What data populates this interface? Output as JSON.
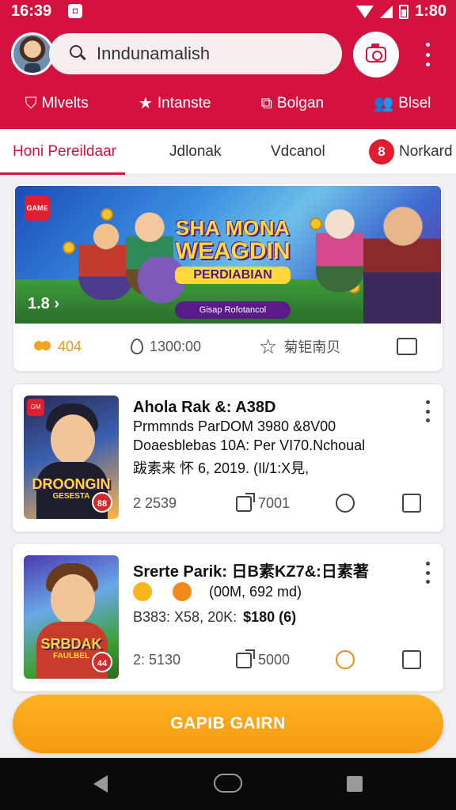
{
  "status_bar": {
    "time": "16:39",
    "right_time": "1:80"
  },
  "header": {
    "search_value": "Inndunamalish",
    "categories": [
      {
        "label": "Mlvelts",
        "icon": "shield-icon"
      },
      {
        "label": "Intanste",
        "icon": "star-icon"
      },
      {
        "label": "Bolgan",
        "icon": "box-icon"
      },
      {
        "label": "Blsel",
        "icon": "users-icon"
      }
    ]
  },
  "tabs": [
    {
      "label": "Honi Pereildaar"
    },
    {
      "label": "Jdlonak"
    },
    {
      "label": "Vdcanol"
    },
    {
      "label": "Norkard",
      "badge": "8"
    }
  ],
  "featured": {
    "title_line1": "SHA MONA",
    "title_line2": "WEAGDIN",
    "title_line3": "PERDIABIAN",
    "pill_text": "Gisap Rofotancol",
    "pager": "1.8",
    "likes": "404",
    "location": "1300:00",
    "fav_text": "菊钜南贝"
  },
  "posts": [
    {
      "title": "Ahola Rak &: A38D",
      "line2": "Prmmnds ParDOM 3980 &8V00",
      "line3": "Doaesblebas 10A: Per VI70.Nchoual",
      "line4": "跋素来 怀 6, 2019. (Il/1:X見,",
      "thumb_title": "DROONGIN",
      "thumb_sub": "GESESTA",
      "thumb_badge": "88",
      "views": "2 2539",
      "shares": "7001"
    },
    {
      "title": "Srerte Parik: 日B素KZ7&:日素著",
      "line2": "(00M, 692 md)",
      "line3": "B383: X58, 20K:",
      "price": "$180 (6)",
      "thumb_title": "SRBDAK",
      "thumb_sub": "FAULBEL",
      "thumb_badge": "44",
      "views": "2: 5130",
      "shares": "5000"
    }
  ],
  "cta": {
    "label": "GAPIB GAIRN"
  },
  "colors": {
    "primary": "#d3123f",
    "cta": "#f7a21b",
    "accent_orange": "#ec8a1d"
  }
}
